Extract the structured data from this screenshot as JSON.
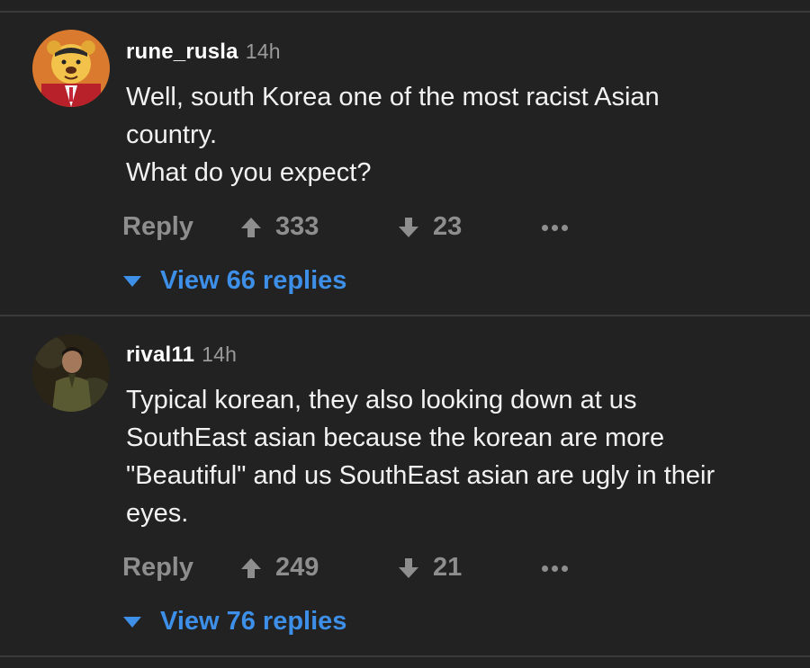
{
  "comments": [
    {
      "username": "rune_rusla",
      "time": "14h",
      "lines": [
        "Well, south Korea one of the most racist Asian",
        "country.",
        "What do you expect?"
      ],
      "reply_label": "Reply",
      "upvotes": "333",
      "downvotes": "23",
      "view_replies": "View 66 replies",
      "avatar_icon": "cartoon-bear-face-avatar"
    },
    {
      "username": "rival11",
      "time": "14h",
      "lines": [
        "Typical korean, they also looking down at us",
        "SouthEast asian because the korean are more",
        "\"Beautiful\" and us SouthEast asian are ugly in their",
        "eyes."
      ],
      "reply_label": "Reply",
      "upvotes": "249",
      "downvotes": "21",
      "view_replies": "View 76 replies",
      "avatar_icon": "person-photo-avatar"
    }
  ],
  "colors": {
    "background": "#222222",
    "divider": "#3a3a3a",
    "muted": "#8e8e8e",
    "link": "#3d8fe8"
  }
}
